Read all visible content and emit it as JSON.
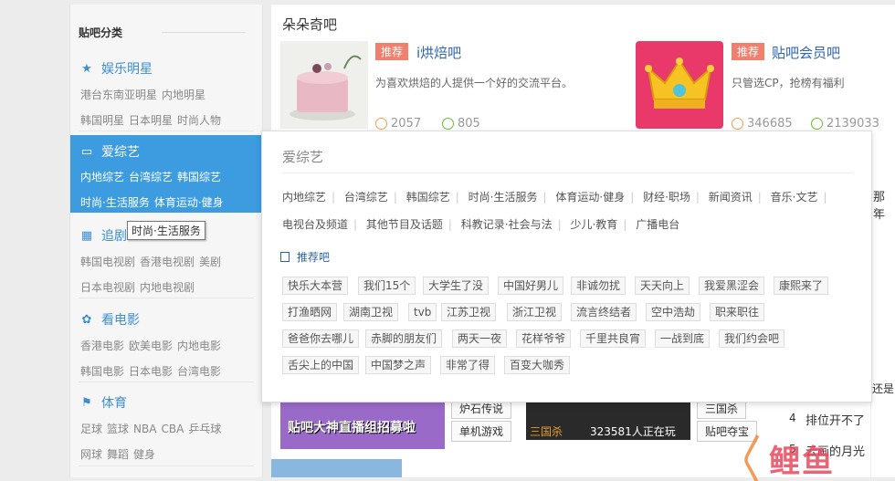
{
  "sidebar": {
    "title": "贴吧分类",
    "categories": [
      {
        "icon": "star-icon",
        "label": "娱乐明星",
        "rows": [
          [
            "港台东南亚明星",
            "内地明星"
          ],
          [
            "韩国明星",
            "日本明星",
            "时尚人物"
          ]
        ]
      },
      {
        "icon": "tv-icon",
        "label": "爱综艺",
        "rows": [
          [
            "内地综艺",
            "台湾综艺",
            "韩国综艺"
          ],
          [
            "时尚·生活服务",
            "体育运动·健身"
          ]
        ]
      },
      {
        "icon": "film-strip-icon",
        "label": "追剧",
        "rows": [
          [
            "韩国电视剧",
            "香港电视剧",
            "美剧"
          ],
          [
            "日本电视剧",
            "内地电视剧"
          ]
        ]
      },
      {
        "icon": "film-reel-icon",
        "label": "看电影",
        "rows": [
          [
            "香港电影",
            "欧美电影",
            "内地电影"
          ],
          [
            "韩国电影",
            "日本电影",
            "台湾电影"
          ]
        ]
      },
      {
        "icon": "sports-icon",
        "label": "体育",
        "rows": [
          [
            "足球",
            "篮球",
            "NBA",
            "CBA",
            "乒乓球"
          ],
          [
            "网球",
            "舞蹈",
            "健身"
          ]
        ]
      }
    ],
    "tooltip": "时尚·生活服务"
  },
  "main": {
    "section_title": "朵朵奇吧",
    "cards": [
      {
        "badge": "推荐",
        "name": "i烘焙吧",
        "desc": "为喜欢烘焙的人提供一个好的交流平台。",
        "members": "2057",
        "posts": "805"
      },
      {
        "badge": "推荐",
        "name": "贴吧会员吧",
        "desc": "只管选CP，抢榜有福利",
        "members": "346685",
        "posts": "2139033"
      }
    ]
  },
  "popup": {
    "title": "爱综艺",
    "subcats_row1": [
      "内地综艺",
      "台湾综艺",
      "韩国综艺",
      "时尚·生活服务",
      "体育运动·健身",
      "财经·职场",
      "新闻资讯",
      "音乐·文艺"
    ],
    "subcats_row2": [
      "电视台及频道",
      "其他节目及话题",
      "科教记录·社会与法",
      "少儿·教育",
      "广播电台"
    ],
    "rec_label": "推荐吧",
    "tags": [
      [
        "快乐大本营",
        "我们15个",
        "大学生了没",
        "中国好男儿",
        "非诚勿扰",
        "天天向上",
        "我爱黑涩会",
        "康熙来了"
      ],
      [
        "打渔晒网",
        "湖南卫视",
        "tvb",
        "江苏卫视",
        "浙江卫视",
        "流言终结者",
        "空中浩劫",
        "职来职往"
      ],
      [
        "爸爸你去哪儿",
        "赤脚的朋友们",
        "两天一夜",
        "花样爷爷",
        "千里共良宵",
        "一战到底",
        "我们约会吧"
      ],
      [
        "舌尖上的中国",
        "中国梦之声",
        "非常了得",
        "百变大咖秀"
      ]
    ]
  },
  "below": {
    "banner_text": "贴吧大神直播组招募啦",
    "btn1": "单机游戏",
    "btn2": "炉石传说",
    "game_name": "三国杀",
    "online": "323581人正在玩",
    "btn3": "贴吧夺宝",
    "btn4": "三国杀",
    "right_partial_1": "那年",
    "right_partial_2": "7",
    "right_partial_3": "还是",
    "list_item_4": "排位开不了",
    "list_item_5": "云画的月光",
    "list_num_4": "4",
    "list_num_5": "5"
  },
  "watermark": "鲤鱼"
}
